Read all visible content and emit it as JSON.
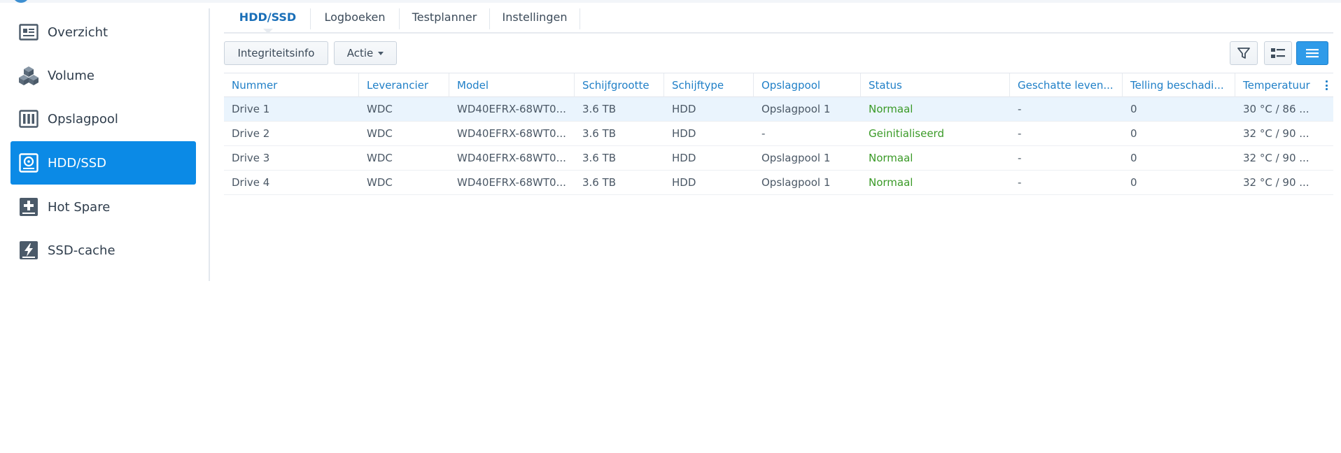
{
  "sidebar": {
    "items": [
      {
        "label": "Overzicht",
        "icon": "overview-icon"
      },
      {
        "label": "Volume",
        "icon": "volume-icon"
      },
      {
        "label": "Opslagpool",
        "icon": "storage-pool-icon"
      },
      {
        "label": "HDD/SSD",
        "icon": "hdd-icon",
        "active": true
      },
      {
        "label": "Hot Spare",
        "icon": "hot-spare-icon"
      },
      {
        "label": "SSD-cache",
        "icon": "ssd-cache-icon"
      }
    ]
  },
  "tabs": [
    {
      "label": "HDD/SSD",
      "active": true
    },
    {
      "label": "Logboeken"
    },
    {
      "label": "Testplanner"
    },
    {
      "label": "Instellingen"
    }
  ],
  "toolbar": {
    "integrity_label": "Integriteitsinfo",
    "action_label": "Actie",
    "filter_icon": "filter-icon",
    "list_view_icon": "detail-list-icon",
    "compact_view_icon": "compact-list-icon"
  },
  "table": {
    "headers": [
      "Nummer",
      "Leverancier",
      "Model",
      "Schijfgrootte",
      "Schijftype",
      "Opslagpool",
      "Status",
      "Geschatte leven...",
      "Telling beschadi...",
      "Temperatuur"
    ],
    "rows": [
      [
        "Drive 1",
        "WDC",
        "WD40EFRX-68WT0...",
        "3.6 TB",
        "HDD",
        "Opslagpool 1",
        "Normaal",
        "-",
        "0",
        "30 °C / 86 ..."
      ],
      [
        "Drive 2",
        "WDC",
        "WD40EFRX-68WT0...",
        "3.6 TB",
        "HDD",
        "-",
        "Geinitialiseerd",
        "-",
        "0",
        "32 °C / 90 ..."
      ],
      [
        "Drive 3",
        "WDC",
        "WD40EFRX-68WT0...",
        "3.6 TB",
        "HDD",
        "Opslagpool 1",
        "Normaal",
        "-",
        "0",
        "32 °C / 90 ..."
      ],
      [
        "Drive 4",
        "WDC",
        "WD40EFRX-68WT0...",
        "3.6 TB",
        "HDD",
        "Opslagpool 1",
        "Normaal",
        "-",
        "0",
        "32 °C / 90 ..."
      ]
    ],
    "selected_row": 0
  },
  "colors": {
    "accent": "#0b8ae6",
    "header_text": "#1f7fc7",
    "status_ok": "#3a9a27"
  }
}
